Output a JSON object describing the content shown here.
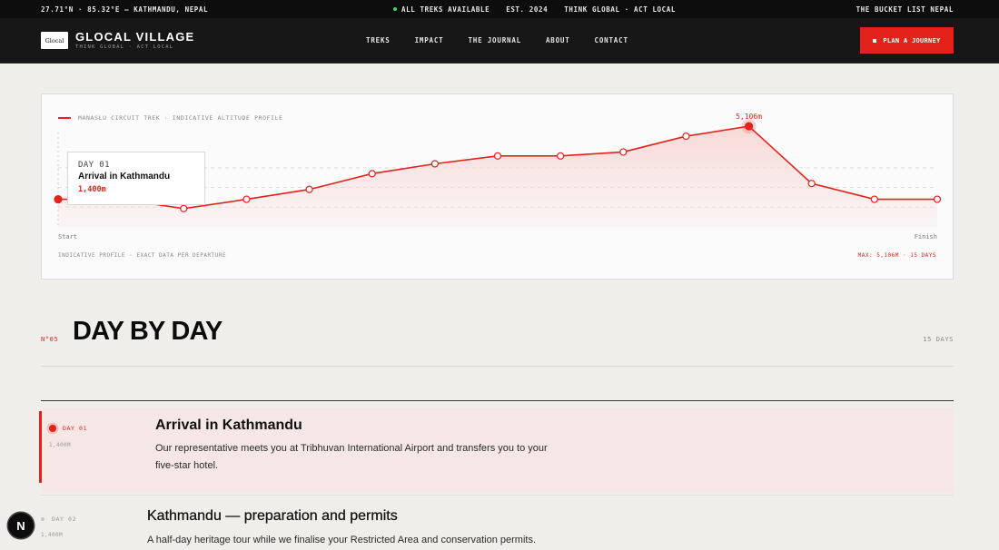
{
  "topbar": {
    "coords": "27.71°N · 85.32°E — KATHMANDU, NEPAL",
    "status": "ALL TREKS AVAILABLE",
    "est": "EST. 2024",
    "motto": "THINK GLOBAL · ACT LOCAL",
    "right": "THE BUCKET LIST NEPAL"
  },
  "nav": {
    "logo_text": "Glocal",
    "brand": "GLOCAL VILLAGE",
    "tagline": "THINK GLOBAL · ACT LOCAL",
    "links": [
      "TREKS",
      "IMPACT",
      "THE JOURNAL",
      "ABOUT",
      "CONTACT"
    ],
    "cta": "PLAN A JOURNEY"
  },
  "chart_data": {
    "type": "area",
    "legend": "MANASLU CIRCUIT TREK · INDICATIVE ALTITUDE PROFILE",
    "x_start_label": "Start",
    "x_end_label": "Finish",
    "y": [
      1400,
      1400,
      930,
      1400,
      1900,
      2700,
      3200,
      3600,
      3600,
      3800,
      4600,
      5106,
      2200,
      1400,
      1400
    ],
    "peak_label": "5,106m",
    "peak_index": 11,
    "highlight_index": 0,
    "ylim": [
      0,
      5800
    ],
    "grid": "dashed horizontal",
    "tooltip": {
      "day": "DAY 01",
      "title": "Arrival in Kathmandu",
      "altitude": "1,400m"
    },
    "footer_left": "INDICATIVE PROFILE · EXACT DATA PER DEPARTURE",
    "footer_right": "MAX: 5,106M · 15 DAYS",
    "colors": {
      "line": "#e3221b",
      "fill": "#f6d6d4"
    }
  },
  "section": {
    "number": "N°05",
    "title": "DAY BY DAY",
    "count": "15 DAYS"
  },
  "days": [
    {
      "label": "DAY 01",
      "altitude": "1,400M",
      "title": "Arrival in Kathmandu",
      "description": "Our representative meets you at Tribhuvan International Airport and transfers you to your five-star hotel."
    },
    {
      "label": "DAY 02",
      "altitude": "1,400M",
      "title": "Kathmandu — preparation and permits",
      "description": "A half-day heritage tour while we finalise your Restricted Area and conservation permits."
    }
  ],
  "fab": {
    "label": "N"
  }
}
